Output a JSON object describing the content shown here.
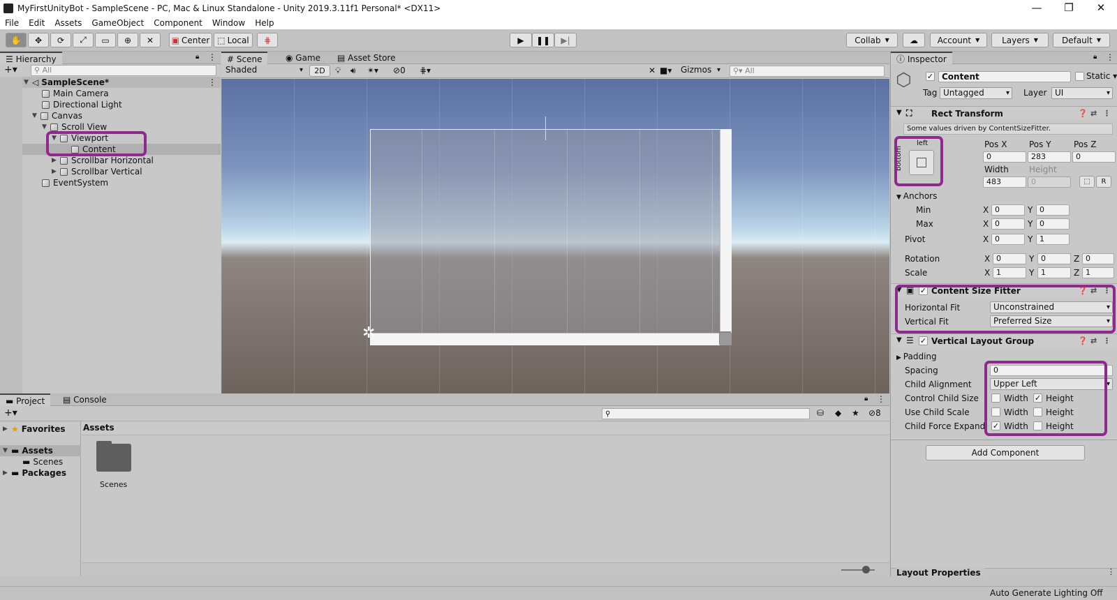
{
  "window": {
    "title": "MyFirstUnityBot - SampleScene - PC, Mac & Linux Standalone - Unity 2019.3.11f1 Personal* <DX11>",
    "minimize": "—",
    "maximize": "❐",
    "close": "✕"
  },
  "menu": [
    "File",
    "Edit",
    "Assets",
    "GameObject",
    "Component",
    "Window",
    "Help"
  ],
  "toolbar": {
    "center": "Center",
    "local": "Local",
    "collab": "Collab",
    "account": "Account",
    "layers": "Layers",
    "layout": "Default"
  },
  "hierarchy": {
    "tab": "Hierarchy",
    "search_placeholder": "All",
    "scene": "SampleScene*",
    "items": [
      "Main Camera",
      "Directional Light",
      "Canvas",
      "Scroll View",
      "Viewport",
      "Content",
      "Scrollbar Horizontal",
      "Scrollbar Vertical",
      "EventSystem"
    ]
  },
  "scene": {
    "tabs": [
      "Scene",
      "Game",
      "Asset Store"
    ],
    "shading": "Shaded",
    "mode2d": "2D",
    "hidden_count": "0",
    "gizmos": "Gizmos",
    "search_placeholder": "All"
  },
  "project": {
    "tabs": [
      "Project",
      "Console"
    ],
    "hidden_count": "8",
    "favorites": "Favorites",
    "assets": "Assets",
    "scenes": "Scenes",
    "packages": "Packages",
    "breadcrumb": "Assets",
    "folder_label": "Scenes"
  },
  "inspector": {
    "tab": "Inspector",
    "object_name": "Content",
    "static_label": "Static",
    "tag_label": "Tag",
    "tag_value": "Untagged",
    "layer_label": "Layer",
    "layer_value": "UI",
    "rect_transform": {
      "title": "Rect Transform",
      "note": "Some values driven by ContentSizeFitter.",
      "anchor_h": "left",
      "anchor_v": "bottom",
      "posx_label": "Pos X",
      "posx": "0",
      "posy_label": "Pos Y",
      "posy": "283",
      "posz_label": "Pos Z",
      "posz": "0",
      "width_label": "Width",
      "width": "483",
      "height_label": "Height",
      "height": "0",
      "anchors": "Anchors",
      "min": "Min",
      "min_x": "0",
      "min_y": "0",
      "max": "Max",
      "max_x": "0",
      "max_y": "0",
      "pivot": "Pivot",
      "pivot_x": "0",
      "pivot_y": "1",
      "rotation": "Rotation",
      "rot_x": "0",
      "rot_y": "0",
      "rot_z": "0",
      "scale": "Scale",
      "scale_x": "1",
      "scale_y": "1",
      "scale_z": "1",
      "x": "X",
      "y": "Y",
      "z": "Z",
      "r_button": "R"
    },
    "csf": {
      "title": "Content Size Fitter",
      "hfit_label": "Horizontal Fit",
      "hfit": "Unconstrained",
      "vfit_label": "Vertical Fit",
      "vfit": "Preferred Size"
    },
    "vlg": {
      "title": "Vertical Layout Group",
      "padding": "Padding",
      "spacing_label": "Spacing",
      "spacing": "0",
      "align_label": "Child Alignment",
      "align": "Upper Left",
      "ccs_label": "Control Child Size",
      "ucs_label": "Use Child Scale",
      "cfe_label": "Child Force Expand",
      "width": "Width",
      "height": "Height"
    },
    "add_component": "Add Component",
    "layout_properties": "Layout Properties"
  },
  "status": {
    "lighting": "Auto Generate Lighting Off"
  }
}
